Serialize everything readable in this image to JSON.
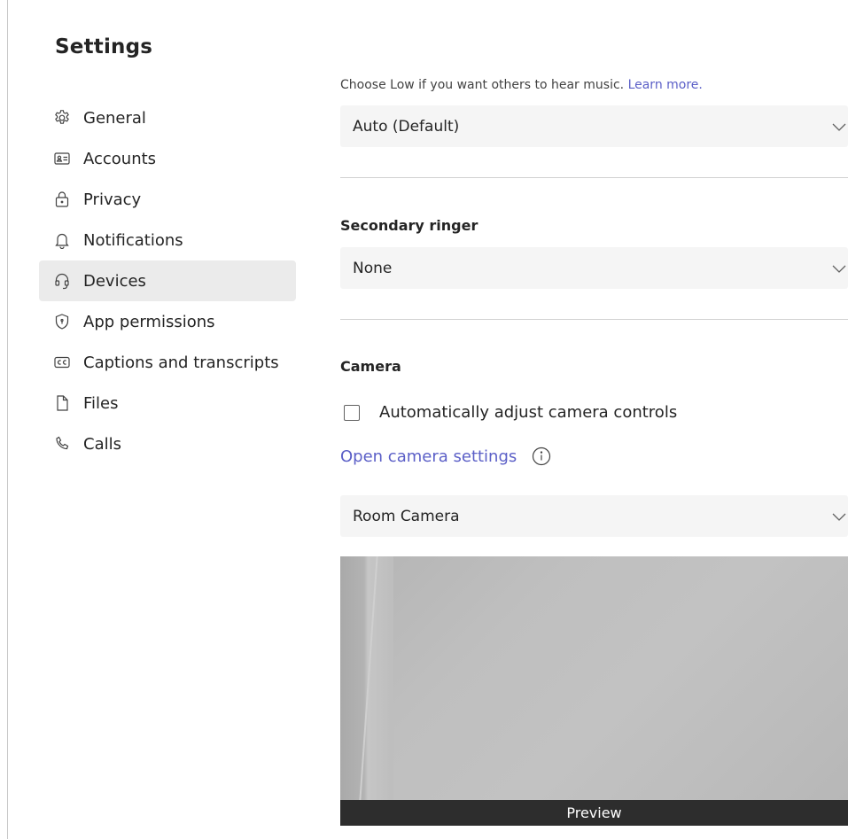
{
  "sidebar": {
    "title": "Settings",
    "items": [
      {
        "label": "General",
        "icon": "gear-icon"
      },
      {
        "label": "Accounts",
        "icon": "id-card-icon"
      },
      {
        "label": "Privacy",
        "icon": "lock-icon"
      },
      {
        "label": "Notifications",
        "icon": "bell-icon"
      },
      {
        "label": "Devices",
        "icon": "headset-icon",
        "active": true
      },
      {
        "label": "App permissions",
        "icon": "shield-icon"
      },
      {
        "label": "Captions and transcripts",
        "icon": "cc-icon"
      },
      {
        "label": "Files",
        "icon": "file-icon"
      },
      {
        "label": "Calls",
        "icon": "phone-icon"
      }
    ]
  },
  "main": {
    "noise_hint": "Choose Low if you want others to hear music.",
    "noise_hint_link": "Learn more.",
    "noise_select_value": "Auto (Default)",
    "secondary_ringer_title": "Secondary ringer",
    "secondary_ringer_value": "None",
    "camera_title": "Camera",
    "auto_adjust_label": "Automatically adjust camera controls",
    "auto_adjust_checked": false,
    "open_camera_settings": "Open camera settings",
    "camera_select_value": "Room Camera",
    "preview_label": "Preview"
  },
  "colors": {
    "accent": "#5b5fc7",
    "active_nav_bg": "#ebebeb",
    "select_bg": "#f5f5f5"
  }
}
